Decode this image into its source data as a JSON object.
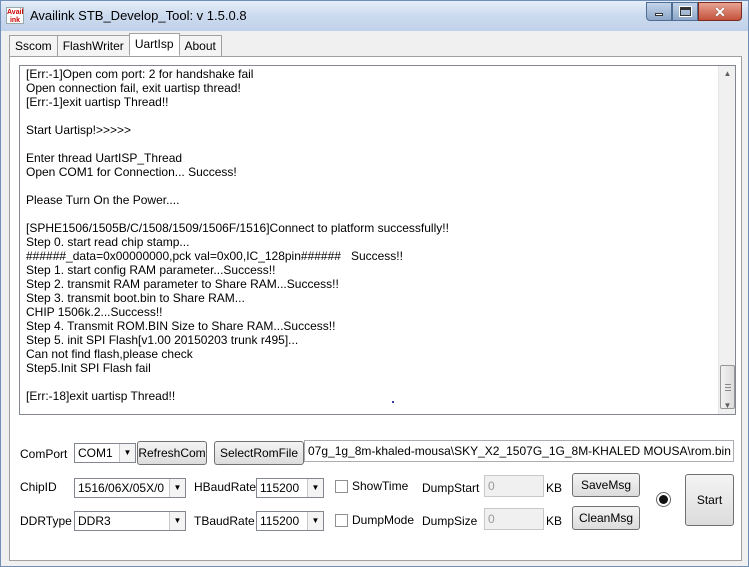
{
  "window": {
    "title": "Availink STB_Develop_Tool: v 1.5.0.8",
    "icon_text": "Avail ink"
  },
  "tabs": [
    {
      "label": "Sscom"
    },
    {
      "label": "FlashWriter"
    },
    {
      "label": "UartIsp"
    },
    {
      "label": "About"
    }
  ],
  "log": {
    "lines": [
      "[Err:-1]Open com port: 2 for handshake fail",
      "Open connection fail, exit uartisp thread!",
      "[Err:-1]exit uartisp Thread!!",
      "",
      "Start Uartisp!>>>>>",
      "",
      "Enter thread UartISP_Thread",
      "Open COM1 for Connection... Success!",
      "",
      "Please Turn On the Power....",
      "",
      "[SPHE1506/1505B/C/1508/1509/1506F/1516]Connect to platform successfully!!",
      "Step 0. start read chip stamp...",
      "######_data=0x00000000,pck val=0x00,IC_128pin######   Success!!",
      "Step 1. start config RAM parameter...Success!!",
      "Step 2. transmit RAM parameter to Share RAM...Success!!",
      "Step 3. transmit boot.bin to Share RAM...",
      "CHIP 1506k.2...Success!!",
      "Step 4. Transmit ROM.BIN Size to Share RAM...Success!!",
      "Step 5. init SPI Flash[v1.00 20150203 trunk r495]...",
      "Can not find flash,please check",
      "Step5.Init SPI Flash fail",
      "",
      "[Err:-18]exit uartisp Thread!!"
    ]
  },
  "controls": {
    "comport_label": "ComPort",
    "comport_value": "COM1",
    "refresh_label": "RefreshCom",
    "select_rom_label": "SelectRomFile",
    "rom_path": "07g_1g_8m-khaled-mousa\\SKY_X2_1507G_1G_8M-KHALED MOUSA\\rom.bin",
    "chipid_label": "ChipID",
    "chipid_value": "1516/06X/05X/0",
    "hbaud_label": "HBaudRate",
    "hbaud_value": "115200",
    "showtime_label": "ShowTime",
    "dumpstart_label": "DumpStart",
    "dumpstart_value": "0",
    "kb_label_1": "KB",
    "savemsg_label": "SaveMsg",
    "start_label": "Start",
    "ddrtype_label": "DDRType",
    "ddrtype_value": "DDR3",
    "tbaud_label": "TBaudRate",
    "tbaud_value": "115200",
    "dumpmode_label": "DumpMode",
    "dumpsize_label": "DumpSize",
    "dumpsize_value": "0",
    "kb_label_2": "KB",
    "cleanmsg_label": "CleanMsg"
  }
}
